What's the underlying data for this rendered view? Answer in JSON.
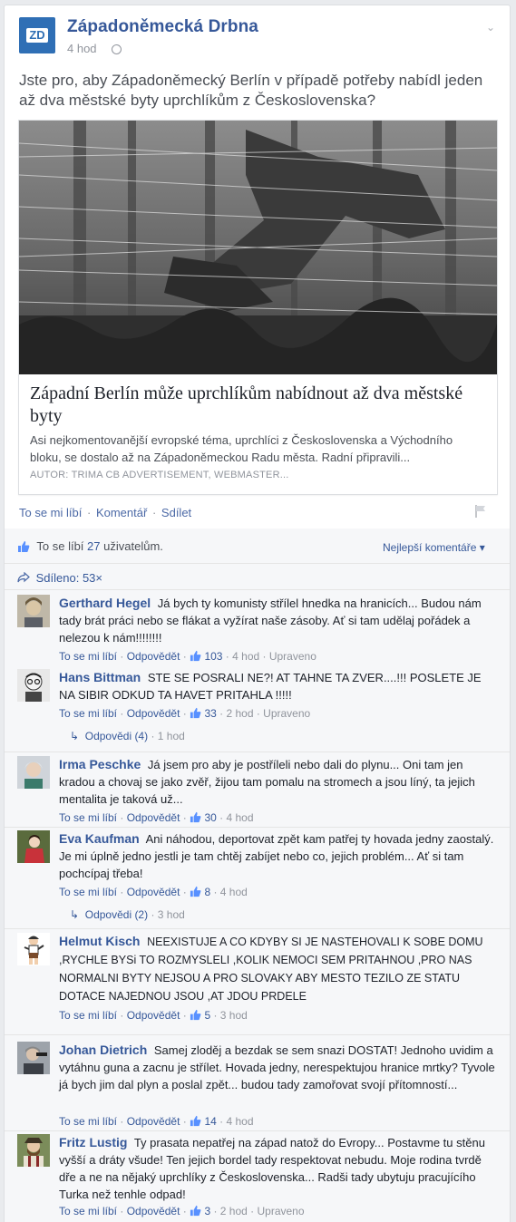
{
  "post": {
    "page_name": "Západoněmecká Drbna",
    "avatar_text": "ZD",
    "time": "4 hod",
    "text": "Jste pro, aby Západoněmecký Berlín v případě potřeby nabídl jeden až dva městské byty uprchlíkům z Československa?",
    "link": {
      "title": "Západní Berlín může uprchlíkům nabídnout až dva městské byty",
      "description": "Asi nejkomentovanější evropské téma, uprchlíci z Československa a Východního bloku, se dostalo až na Západoněmeckou Radu města. Radní připravili...",
      "author": "AUTOR: TRIMA CB ADVERTISEMENT, WEBMASTER..."
    },
    "actions": {
      "like": "To se mi líbí",
      "comment": "Komentář",
      "share": "Sdílet"
    }
  },
  "feedback": {
    "likes_prefix": "To se líbí",
    "likes_count": "27",
    "likes_suffix": "uživatelům.",
    "best_comments": "Nejlepší komentáře ▾",
    "shared": "Sdíleno: 53×"
  },
  "comments": [
    {
      "name": "Gerthard Hegel",
      "text": "Já bych ty komunisty střílel hnedka na hranicích... Budou nám tady brát práci nebo se flákat a vyžírat naše zásoby. Ať si tam udělaj pořádek a nelezou k nám!!!!!!!!",
      "like": "To se mi líbí",
      "reply": "Odpovědět",
      "likes": "103",
      "time": "4 hod",
      "edited": "Upraveno"
    },
    {
      "name": "Hans Bittman",
      "text": "STE SE POSRALI NE?! AT TAHNE TA ZVER....!!! POSLETE JE NA SIBIR ODKUD TA HAVET PRITAHLA !!!!!",
      "like": "To se mi líbí",
      "reply": "Odpovědět",
      "likes": "33",
      "time": "2 hod",
      "edited": "Upraveno",
      "replies": "Odpovědi (4)",
      "replies_time": "1 hod"
    },
    {
      "name": "Irma Peschke",
      "text": "Já jsem pro aby je postříleli nebo dali do plynu... Oni tam jen kradou a chovaj se jako zvěř, žijou tam pomalu na stromech a jsou líný, ta jejich mentalita je taková už...",
      "like": "To se mi líbí",
      "reply": "Odpovědět",
      "likes": "30",
      "time": "4 hod"
    },
    {
      "name": "Eva Kaufman",
      "text": "Ani náhodou, deportovat zpět kam patřej ty hovada jedny zaostalý. Je mi úplně jedno jestli je tam chtěj zabíjet nebo co, jejich problém... Ať si tam pochcípaj třeba!",
      "like": "To se mi líbí",
      "reply": "Odpovědět",
      "likes": "8",
      "time": "4 hod",
      "replies": "Odpovědi (2)",
      "replies_time": "3 hod"
    },
    {
      "name": "Helmut Kisch",
      "text": "NEEXISTUJE A CO KDYBY SI JE NASTEHOVALI K SOBE DOMU ,RYCHLE BYSi TO ROZMYSLELI ,KOLIK NEMOCI SEM PRITAHNOU ,PRO NAS NORMALNI BYTY NEJSOU A PRO SLOVAKY ABY MESTO TEZILO ZE STATU DOTACE NAJEDNOU JSOU ,AT JDOU PRDELE",
      "like": "To se mi líbí",
      "reply": "Odpovědět",
      "likes": "5",
      "time": "3 hod"
    },
    {
      "name": "Johan Dietrich",
      "text": "Samej zloděj a bezdak se sem snazi DOSTAT! Jednoho uvidim a vytáhnu guna a zacnu je střílet. Hovada jedny, nerespektujou hranice mrtky? Tyvole já bych jim dal plyn a poslal zpět... budou tady zamořovat svojí přítomností...",
      "like": "To se mi líbí",
      "reply": "Odpovědět",
      "likes": "14",
      "time": "4 hod"
    },
    {
      "name": "Fritz Lustig",
      "text": "Ty prasata nepatřej na západ natož do Evropy... Postavme tu stěnu vyšší a dráty všude! Ten jejich bordel tady respektovat nebudu. Moje rodina tvrdě dře a ne na nějaký uprchlíky z Československa... Radši tady ubytuju pracujícího Turka než tenhle odpad!",
      "like": "To se mi líbí",
      "reply": "Odpovědět",
      "likes": "3",
      "time": "2 hod",
      "edited": "Upraveno"
    }
  ]
}
